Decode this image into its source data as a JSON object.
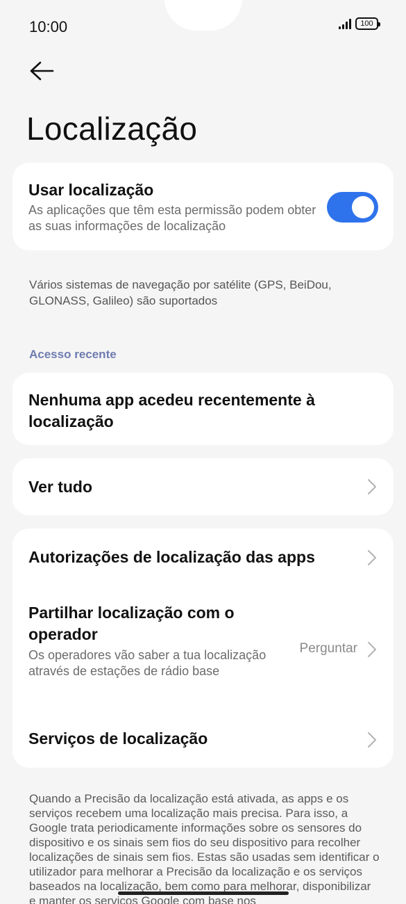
{
  "status_bar": {
    "time": "10:00",
    "battery": "100"
  },
  "header": {
    "back_icon": "arrow-left-icon",
    "title": "Localização"
  },
  "use_location": {
    "title": "Usar localização",
    "description": "As aplicações que têm esta permissão podem obter as suas informações de localização",
    "enabled": true,
    "toggle_color": "#2f73ec"
  },
  "gnss_note": "Vários sistemas de navegação por satélite (GPS, BeiDou, GLONASS, Galileo) são suportados",
  "recent_access": {
    "section_label": "Acesso recente",
    "empty_message": "Nenhuma app acedeu recentemente à localização",
    "see_all_label": "Ver tudo"
  },
  "settings": {
    "app_permissions_label": "Autorizações de localização das apps",
    "share_with_operator": {
      "title": "Partilhar localização com o operador",
      "description": "Os operadores vão saber a tua localização através de estações de rádio base",
      "value": "Perguntar"
    },
    "location_services_label": "Serviços de localização"
  },
  "footer_text": "Quando a Precisão da localização está ativada, as apps e os serviços recebem uma localização mais precisa. Para isso, a Google trata periodicamente informações sobre os sensores do dispositivo e os sinais sem fios do seu dispositivo para recolher localizações de sinais sem fios. Estas são usadas sem identificar o utilizador para melhorar a Precisão da localização e os serviços baseados na localização, bem como para melhorar, disponibilizar e manter os serviços Google com base nos"
}
